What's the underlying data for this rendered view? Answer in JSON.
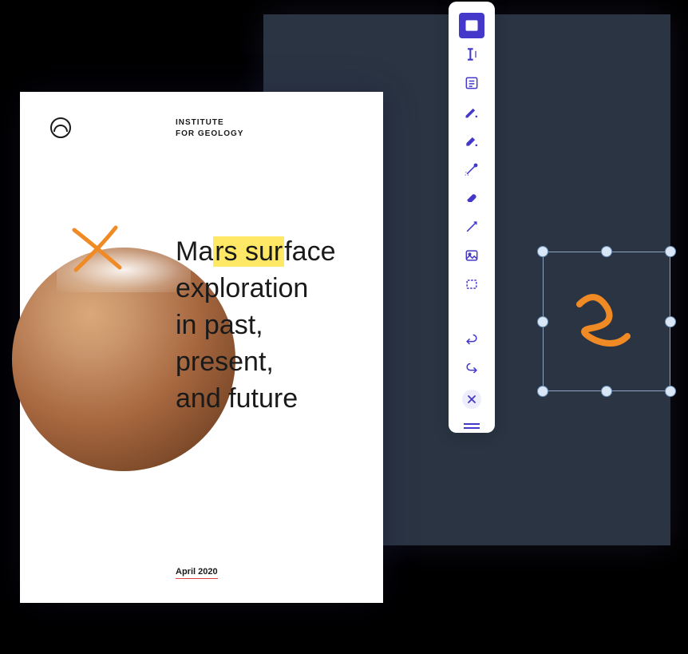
{
  "canvas": {
    "bg_color": "#2a3442"
  },
  "document": {
    "org_line1": "INSTITUTE",
    "org_line2": "FOR GEOLOGY",
    "title_html_parts": {
      "pre": "Ma",
      "highlighted": "rs sur",
      "post": "face\nexploration\nin past,\npresent,\nand future"
    },
    "date": "April 2020"
  },
  "annotations": {
    "x_stroke_color": "#f08a24",
    "scribble_color": "#f08a24"
  },
  "toolbar": {
    "tools": [
      {
        "name": "text-box-tool",
        "active": true
      },
      {
        "name": "text-cursor-tool",
        "active": false
      },
      {
        "name": "note-tool",
        "active": false
      },
      {
        "name": "pen-tool",
        "active": false
      },
      {
        "name": "highlighter-tool",
        "active": false
      },
      {
        "name": "laser-tool",
        "active": false
      },
      {
        "name": "eraser-tool",
        "active": false
      },
      {
        "name": "line-tool",
        "active": false
      },
      {
        "name": "image-tool",
        "active": false
      },
      {
        "name": "shape-tool",
        "active": false
      }
    ],
    "actions": {
      "undo": "undo",
      "redo": "redo",
      "close": "close"
    }
  },
  "colors": {
    "primary": "#4338ca",
    "accent_orange": "#f08a24",
    "highlight_yellow": "#ffe866"
  }
}
